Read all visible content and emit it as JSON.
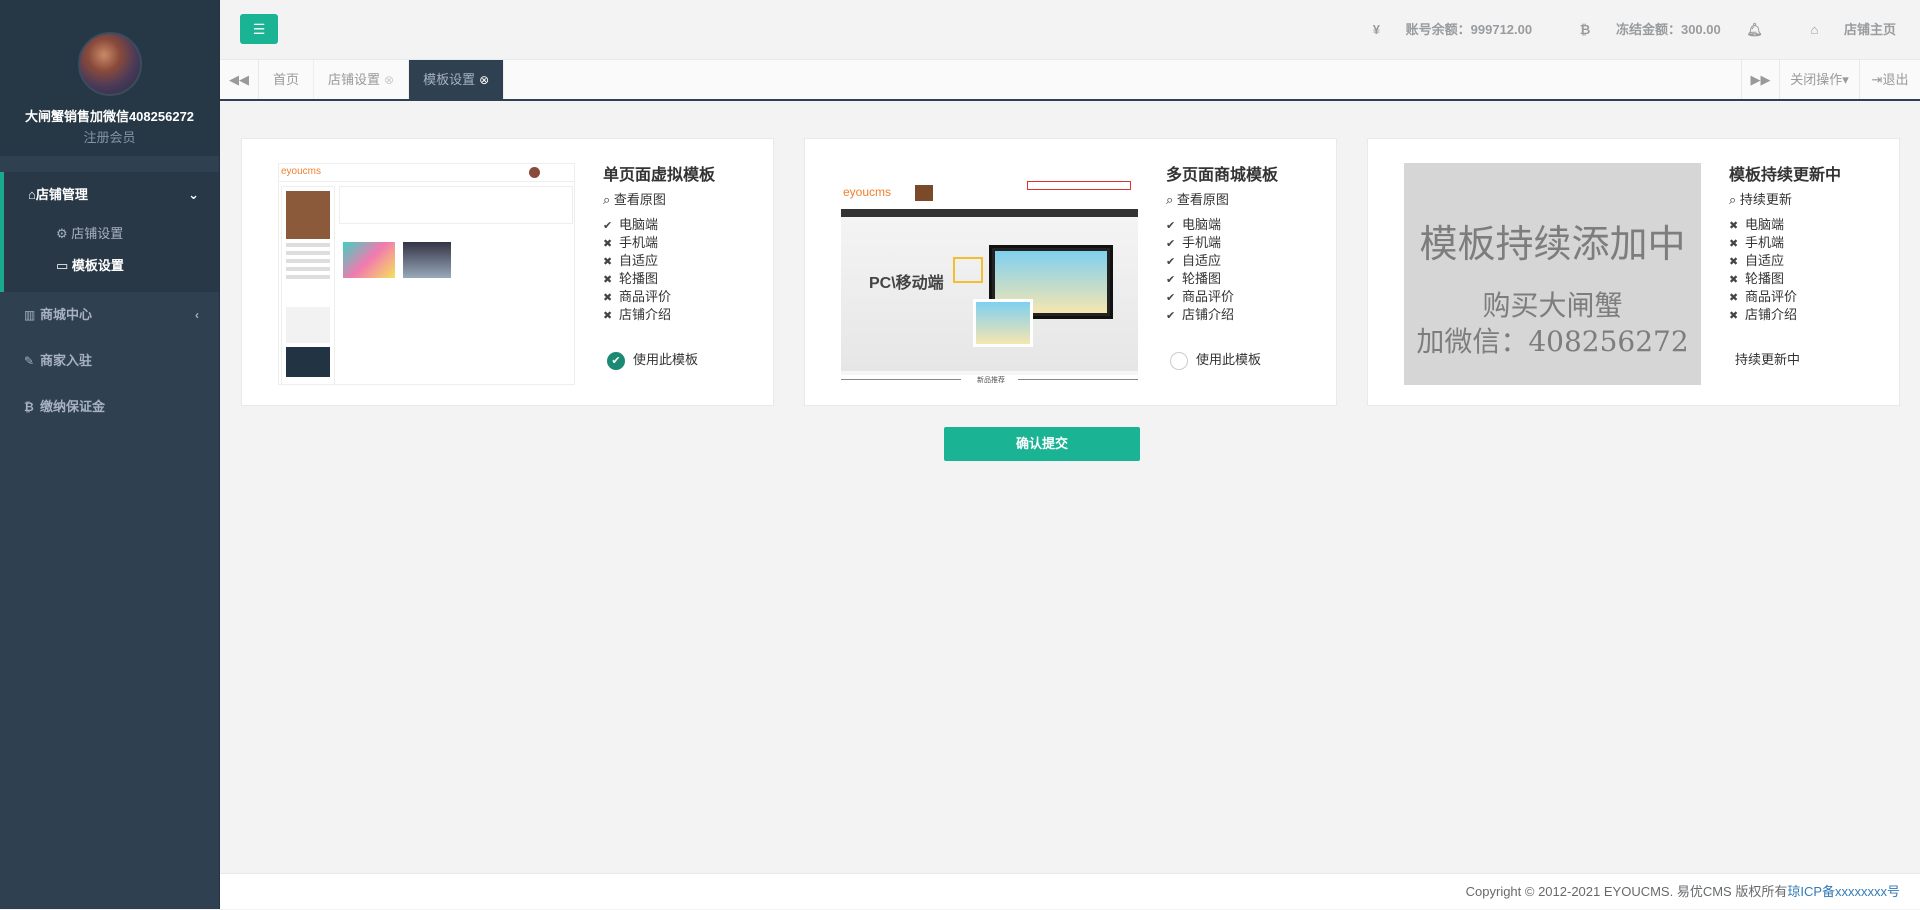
{
  "sidebar": {
    "user_name": "大闸蟹销售加微信408256272",
    "user_role": "注册会员",
    "store_mgmt": "店铺管理",
    "store_settings": "店铺设置",
    "template_settings": "模板设置",
    "mall_center": "商城中心",
    "merchant_join": "商家入驻",
    "deposit": "缴纳保证金"
  },
  "topbar": {
    "balance": "账号余额：999712.00",
    "frozen": "冻结金额：300.00",
    "store_home": "店铺主页"
  },
  "tabs": {
    "home": "首页",
    "store_settings": "店铺设置",
    "template_settings": "模板设置",
    "close_ops": "关闭操作",
    "logout": "退出"
  },
  "templates": [
    {
      "title": "单页面虚拟模板",
      "view": "查看原图",
      "features": [
        {
          "mark": "✔",
          "label": "电脑端"
        },
        {
          "mark": "✖",
          "label": "手机端"
        },
        {
          "mark": "✖",
          "label": "自适应"
        },
        {
          "mark": "✖",
          "label": "轮播图"
        },
        {
          "mark": "✖",
          "label": "商品评价"
        },
        {
          "mark": "✖",
          "label": "店铺介绍"
        }
      ],
      "use_label": "使用此模板",
      "selected": true,
      "thumb_logo": "eyoucms"
    },
    {
      "title": "多页面商城模板",
      "view": "查看原图",
      "features": [
        {
          "mark": "✔",
          "label": "电脑端"
        },
        {
          "mark": "✔",
          "label": "手机端"
        },
        {
          "mark": "✔",
          "label": "自适应"
        },
        {
          "mark": "✔",
          "label": "轮播图"
        },
        {
          "mark": "✔",
          "label": "商品评价"
        },
        {
          "mark": "✔",
          "label": "店铺介绍"
        }
      ],
      "use_label": "使用此模板",
      "selected": false,
      "thumb_logo": "eyoucms",
      "thumb_banner": "PC\\移动端",
      "thumb_footer": "新品推荐"
    },
    {
      "title": "模板持续更新中",
      "view": "持续更新",
      "features": [
        {
          "mark": "✖",
          "label": "电脑端"
        },
        {
          "mark": "✖",
          "label": "手机端"
        },
        {
          "mark": "✖",
          "label": "自适应"
        },
        {
          "mark": "✖",
          "label": "轮播图"
        },
        {
          "mark": "✖",
          "label": "商品评价"
        },
        {
          "mark": "✖",
          "label": "店铺介绍"
        }
      ],
      "use_label": "持续更新中",
      "placeholder_big": "模板持续添加中",
      "placeholder_line1": "购买大闸蟹",
      "placeholder_line2": "加微信：408256272"
    }
  ],
  "submit_label": "确认提交",
  "footer": {
    "copyright": "Copyright © 2012-2021 EYOUCMS. 易优CMS 版权所有",
    "icp": "琼ICP备xxxxxxxx号"
  },
  "colors": {
    "accent": "#1ab394",
    "sidebar": "#2f4050"
  }
}
